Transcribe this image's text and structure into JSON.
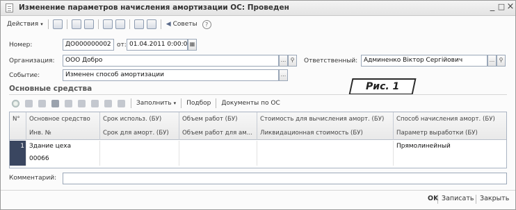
{
  "window": {
    "title": "Изменение параметров начисления амортизации ОС: Проведен",
    "controls": [
      "_",
      "□",
      "×"
    ]
  },
  "toolbar": {
    "actions_label": "Действия",
    "tips_label": "Советы",
    "help_label": "?"
  },
  "form": {
    "number_label": "Номер:",
    "number_value": "ДО000000002",
    "date_label": "от:",
    "date_value": "01.04.2011  0:00:00",
    "org_label": "Организация:",
    "org_value": "ООО Добро",
    "responsible_label": "Ответственный:",
    "responsible_value": "Админенко Віктор Сергійович",
    "event_label": "Событие:",
    "event_value": "Изменен способ амортизации"
  },
  "badge": "Рис. 1",
  "section": {
    "title": "Основные средства"
  },
  "table_toolbar": {
    "fill_label": "Заполнить",
    "pick_label": "Подбор",
    "docs_label": "Документы по ОС"
  },
  "table": {
    "header_row1": [
      "N°",
      "Основное средство",
      "Срок использ. (БУ)",
      "Объем работ (БУ)",
      "Стоимость для вычисления аморт. (БУ)",
      "Способ начисления аморт. (БУ)"
    ],
    "header_row2": [
      "",
      "Инв. №",
      "Срок для аморт. (БУ)",
      "Объем работ для ам...",
      "Ликвидационная стоимость (БУ)",
      "Параметр выработки (БУ)"
    ],
    "rows": [
      {
        "num": "1",
        "asset": "Здание цеха",
        "inv": "00066",
        "useful_life": "",
        "volume": "",
        "cost": "",
        "method": "Прямолинейный"
      }
    ]
  },
  "comment": {
    "label": "Комментарий:",
    "value": ""
  },
  "footer": {
    "ok": "OK",
    "save": "Записать",
    "close": "Закрыть"
  }
}
